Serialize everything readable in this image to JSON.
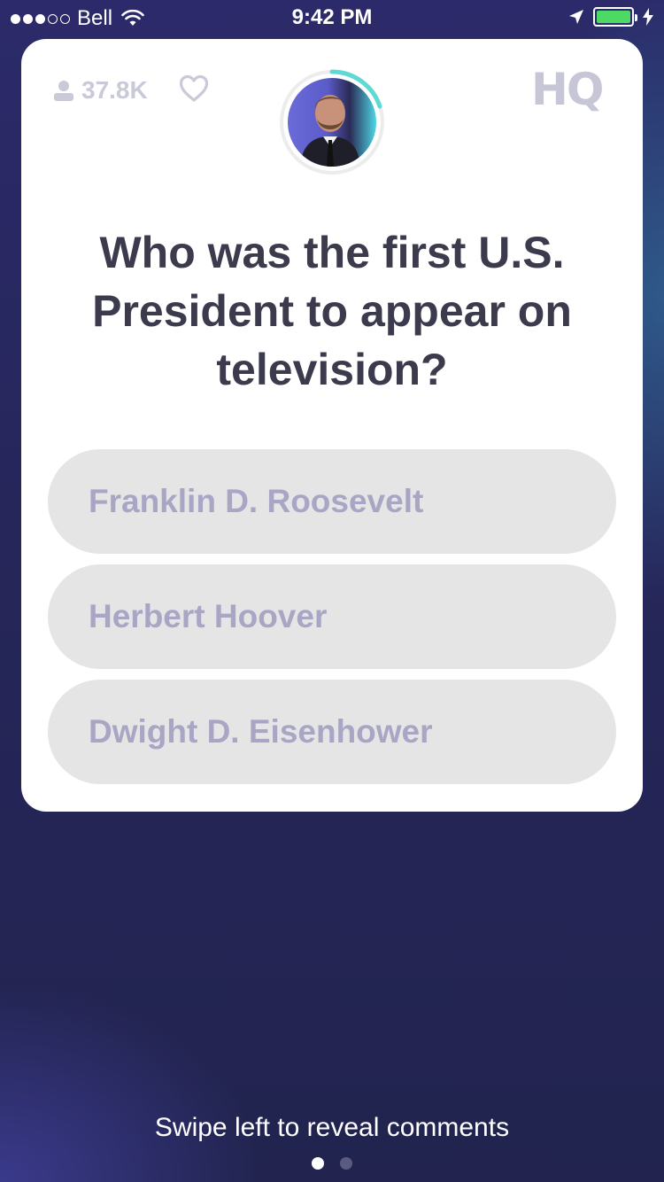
{
  "status_bar": {
    "carrier": "Bell",
    "time": "9:42 PM",
    "signal_bars_filled": 3,
    "signal_bars_total": 5,
    "battery_color": "#4cd964"
  },
  "header": {
    "viewer_count": "37.8K",
    "viewer_icon": "person-icon",
    "like_icon": "heart-icon",
    "logo": "HQ",
    "timer_color": "#5fd9d3"
  },
  "question": {
    "text": "Who was the first U.S. President to appear on television?"
  },
  "answers": [
    {
      "label": "Franklin D. Roosevelt"
    },
    {
      "label": "Herbert Hoover"
    },
    {
      "label": "Dwight D. Eisenhower"
    }
  ],
  "footer": {
    "swipe_hint": "Swipe left to reveal comments",
    "page_index": 1,
    "page_count": 2
  }
}
